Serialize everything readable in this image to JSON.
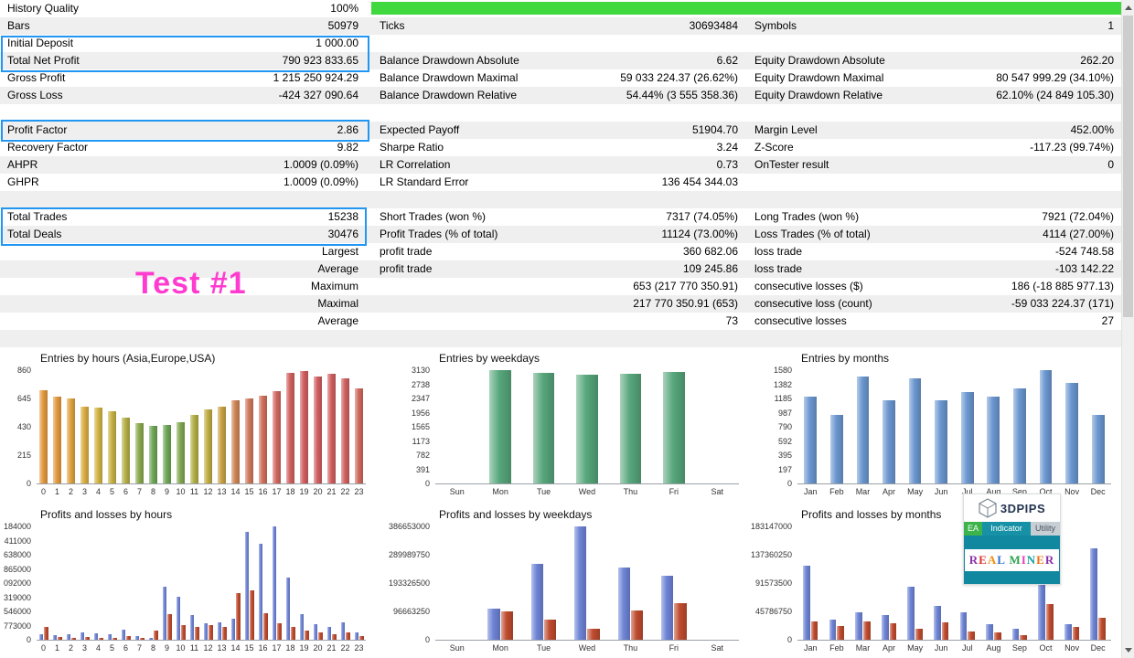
{
  "report": {
    "rows": [
      {
        "ll": "History Quality",
        "lv": "100%",
        "ml": "",
        "mv": "",
        "rl": "",
        "rv": "",
        "shade": false,
        "progress": true
      },
      {
        "ll": "Bars",
        "lv": "50979",
        "ml": "Ticks",
        "mv": "30693484",
        "rl": "Symbols",
        "rv": "1",
        "shade": true
      },
      {
        "ll": "Initial Deposit",
        "lv": "1 000.00",
        "ml": "",
        "mv": "",
        "rl": "",
        "rv": "",
        "shade": false
      },
      {
        "ll": "Total Net Profit",
        "lv": "790 923 833.65",
        "ml": "Balance Drawdown Absolute",
        "mv": "6.62",
        "rl": "Equity Drawdown Absolute",
        "rv": "262.20",
        "shade": true
      },
      {
        "ll": "Gross Profit",
        "lv": "1 215 250 924.29",
        "ml": "Balance Drawdown Maximal",
        "mv": "59 033 224.37 (26.62%)",
        "rl": "Equity Drawdown Maximal",
        "rv": "80 547 999.29 (34.10%)",
        "shade": false
      },
      {
        "ll": "Gross Loss",
        "lv": "-424 327 090.64",
        "ml": "Balance Drawdown Relative",
        "mv": "54.44% (3 555 358.36)",
        "rl": "Equity Drawdown Relative",
        "rv": "62.10% (24 849 105.30)",
        "shade": true
      },
      {
        "ll": "",
        "lv": "",
        "ml": "",
        "mv": "",
        "rl": "",
        "rv": "",
        "shade": false
      },
      {
        "ll": "Profit Factor",
        "lv": "2.86",
        "ml": "Expected Payoff",
        "mv": "51904.70",
        "rl": "Margin Level",
        "rv": "452.00%",
        "shade": true
      },
      {
        "ll": "Recovery Factor",
        "lv": "9.82",
        "ml": "Sharpe Ratio",
        "mv": "3.24",
        "rl": "Z-Score",
        "rv": "-117.23 (99.74%)",
        "shade": false
      },
      {
        "ll": "AHPR",
        "lv": "1.0009 (0.09%)",
        "ml": "LR Correlation",
        "mv": "0.73",
        "rl": "OnTester result",
        "rv": "0",
        "shade": true
      },
      {
        "ll": "GHPR",
        "lv": "1.0009 (0.09%)",
        "ml": "LR Standard Error",
        "mv": "136 454 344.03",
        "rl": "",
        "rv": "",
        "shade": false
      },
      {
        "ll": "",
        "lv": "",
        "ml": "",
        "mv": "",
        "rl": "",
        "rv": "",
        "shade": true
      },
      {
        "ll": "Total Trades",
        "lv": "15238",
        "ml": "Short Trades (won %)",
        "mv": "7317 (74.05%)",
        "rl": "Long Trades (won %)",
        "rv": "7921 (72.04%)",
        "shade": false
      },
      {
        "ll": "Total Deals",
        "lv": "30476",
        "ml": "Profit Trades (% of total)",
        "mv": "11124 (73.00%)",
        "rl": "Loss Trades (% of total)",
        "rv": "4114 (27.00%)",
        "shade": true
      },
      {
        "ll": "",
        "lv": "Largest",
        "ml": "profit trade",
        "mv": "360 682.06",
        "rl": "loss trade",
        "rv": "-524 748.58",
        "shade": false
      },
      {
        "ll": "",
        "lv": "Average",
        "ml": "profit trade",
        "mv": "109 245.86",
        "rl": "loss trade",
        "rv": "-103 142.22",
        "shade": true
      },
      {
        "ll": "",
        "lv": "Maximum",
        "ml": "",
        "mv": "653 (217 770 350.91)",
        "rl": "consecutive losses ($)",
        "rv": "186 (-18 885 977.13)",
        "shade": false
      },
      {
        "ll": "",
        "lv": "Maximal",
        "ml": "",
        "mv": "217 770 350.91 (653)",
        "rl": "consecutive loss (count)",
        "rv": "-59 033 224.37 (171)",
        "shade": true
      },
      {
        "ll": "",
        "lv": "Average",
        "ml": "",
        "mv": "73",
        "rl": "consecutive losses",
        "rv": "27",
        "shade": false
      },
      {
        "ll": "",
        "lv": "",
        "ml": "",
        "mv": "",
        "rl": "",
        "rv": "",
        "shade": true
      }
    ]
  },
  "overlay": {
    "label": "Test #1",
    "color": "#ff3bd0"
  },
  "colors": {
    "accent_highlight": "#2196f3",
    "progress_green": "#3fd83f",
    "row_shade": "#efefef",
    "profit_blue": "#6e84d6",
    "loss_red": "#bf4b2e"
  },
  "chart_data": [
    {
      "type": "bar",
      "title": "Entries by hours (Asia,Europe,USA)",
      "categories": [
        "0",
        "1",
        "2",
        "3",
        "4",
        "5",
        "6",
        "7",
        "8",
        "9",
        "10",
        "11",
        "12",
        "13",
        "14",
        "15",
        "16",
        "17",
        "18",
        "19",
        "20",
        "21",
        "22",
        "23"
      ],
      "values": [
        705,
        660,
        645,
        580,
        575,
        545,
        500,
        455,
        440,
        445,
        465,
        520,
        560,
        585,
        630,
        645,
        665,
        700,
        840,
        855,
        810,
        830,
        800,
        720
      ],
      "bar_colors": [
        "#e2993e",
        "#e2993e",
        "#dfa23f",
        "#d9ad40",
        "#d2b442",
        "#c6b243",
        "#b5ae46",
        "#8aa84d",
        "#6ea656",
        "#6ea656",
        "#80a750",
        "#b2ae46",
        "#c0ac44",
        "#c9a143",
        "#cd8455",
        "#cf785a",
        "#d06f5c",
        "#d0685e",
        "#d06160",
        "#d05e60",
        "#d05e60",
        "#d05e60",
        "#d06060",
        "#d0685d"
      ],
      "ytick_labels": [
        "860",
        "645",
        "430",
        "215",
        "0"
      ],
      "ymax": 860,
      "xlabel": "",
      "ylabel": ""
    },
    {
      "type": "bar",
      "title": "Entries by weekdays",
      "categories": [
        "Sun",
        "Mon",
        "Tue",
        "Wed",
        "Thu",
        "Fri",
        "Sat"
      ],
      "values": [
        0,
        3130,
        3055,
        3000,
        3040,
        3085,
        0
      ],
      "bar_color": "#57a77c",
      "ytick_labels": [
        "3130",
        "2738",
        "2347",
        "1956",
        "1565",
        "1173",
        "782",
        "391",
        "0"
      ],
      "ymax": 3130,
      "xlabel": "",
      "ylabel": ""
    },
    {
      "type": "bar",
      "title": "Entries by months",
      "categories": [
        "Jan",
        "Feb",
        "Mar",
        "Apr",
        "May",
        "Jun",
        "Jul",
        "Aug",
        "Sep",
        "Oct",
        "Nov",
        "Dec"
      ],
      "values": [
        1210,
        960,
        1490,
        1160,
        1460,
        1160,
        1270,
        1210,
        1330,
        1580,
        1405,
        950
      ],
      "bar_color": "#6b97d0",
      "ytick_labels": [
        "1580",
        "1382",
        "1185",
        "987",
        "790",
        "592",
        "395",
        "197",
        "0"
      ],
      "ymax": 1580,
      "xlabel": "",
      "ylabel": ""
    },
    {
      "type": "bar",
      "title": "Profits and losses by hours",
      "categories": [
        "0",
        "1",
        "2",
        "3",
        "4",
        "5",
        "6",
        "7",
        "8",
        "9",
        "10",
        "11",
        "12",
        "13",
        "14",
        "15",
        "16",
        "17",
        "18",
        "19",
        "20",
        "21",
        "22",
        "23"
      ],
      "series": [
        {
          "name": "profit",
          "color": "#6e84d6",
          "values": [
            300000,
            250000,
            300000,
            400000,
            350000,
            300000,
            550000,
            200000,
            120000,
            2900000,
            2350000,
            1350000,
            900000,
            950000,
            1150000,
            5900000,
            5250000,
            6184000,
            3400000,
            1400000,
            850000,
            700000,
            950000,
            400000
          ]
        },
        {
          "name": "loss",
          "color": "#bf4b2e",
          "values": [
            700000,
            150000,
            100000,
            150000,
            100000,
            100000,
            200000,
            100000,
            500000,
            1400000,
            800000,
            700000,
            800000,
            700000,
            2550000,
            2700000,
            1450000,
            900000,
            700000,
            500000,
            400000,
            300000,
            400000,
            200000
          ]
        }
      ],
      "ytick_labels": [
        "184000",
        "411000",
        "638000",
        "865000",
        "092000",
        "319000",
        "546000",
        "773000",
        "0"
      ],
      "ymax": 6184000,
      "xlabel": "",
      "ylabel": ""
    },
    {
      "type": "bar",
      "title": "Profits and losses by weekdays",
      "categories": [
        "Sun",
        "Mon",
        "Tue",
        "Wed",
        "Thu",
        "Fri",
        "Sat"
      ],
      "series": [
        {
          "name": "profit",
          "color": "#6e84d6",
          "values": [
            0,
            105000000,
            258000000,
            386653000,
            245000000,
            218000000,
            0
          ]
        },
        {
          "name": "loss",
          "color": "#bf4b2e",
          "values": [
            0,
            97000000,
            68000000,
            36000000,
            100000000,
            124000000,
            0
          ]
        }
      ],
      "ytick_labels": [
        "386653000",
        "289989750",
        "193326500",
        "96663250",
        "0"
      ],
      "ymax": 386653000,
      "xlabel": "",
      "ylabel": ""
    },
    {
      "type": "bar",
      "title": "Profits and losses by months",
      "categories": [
        "Jan",
        "Feb",
        "Mar",
        "Apr",
        "May",
        "Jun",
        "Jul",
        "Aug",
        "Sep",
        "Oct",
        "Nov",
        "Dec"
      ],
      "series": [
        {
          "name": "profit",
          "color": "#6e84d6",
          "values": [
            120000000,
            33000000,
            45000000,
            40000000,
            86000000,
            55000000,
            45000000,
            25000000,
            18000000,
            113000000,
            25000000,
            147000000
          ]
        },
        {
          "name": "loss",
          "color": "#bf4b2e",
          "values": [
            30000000,
            22000000,
            30000000,
            26000000,
            18000000,
            28000000,
            14000000,
            12000000,
            7000000,
            57000000,
            20000000,
            35000000
          ]
        }
      ],
      "ytick_labels": [
        "183147000",
        "137360250",
        "91573500",
        "45786750",
        "0"
      ],
      "ymax": 183147000,
      "xlabel": "",
      "ylabel": ""
    }
  ],
  "logo": {
    "brand": "3DPIPS",
    "strip": [
      "EA",
      "Indicator",
      "Utility"
    ],
    "real_miner": {
      "text": "REAL MINER",
      "letter_colors": [
        "#8a2fa8",
        "#e03030",
        "#f09010",
        "#2f6fd0",
        "#000000",
        "#2da44e",
        "#e83fb8",
        "#19a0a0",
        "#f07010",
        "#8a2fa8"
      ]
    }
  },
  "icons": {
    "scroll_up": "triangle-up",
    "scroll_down": "triangle-down",
    "logo_cube": "cube-wireframe"
  }
}
